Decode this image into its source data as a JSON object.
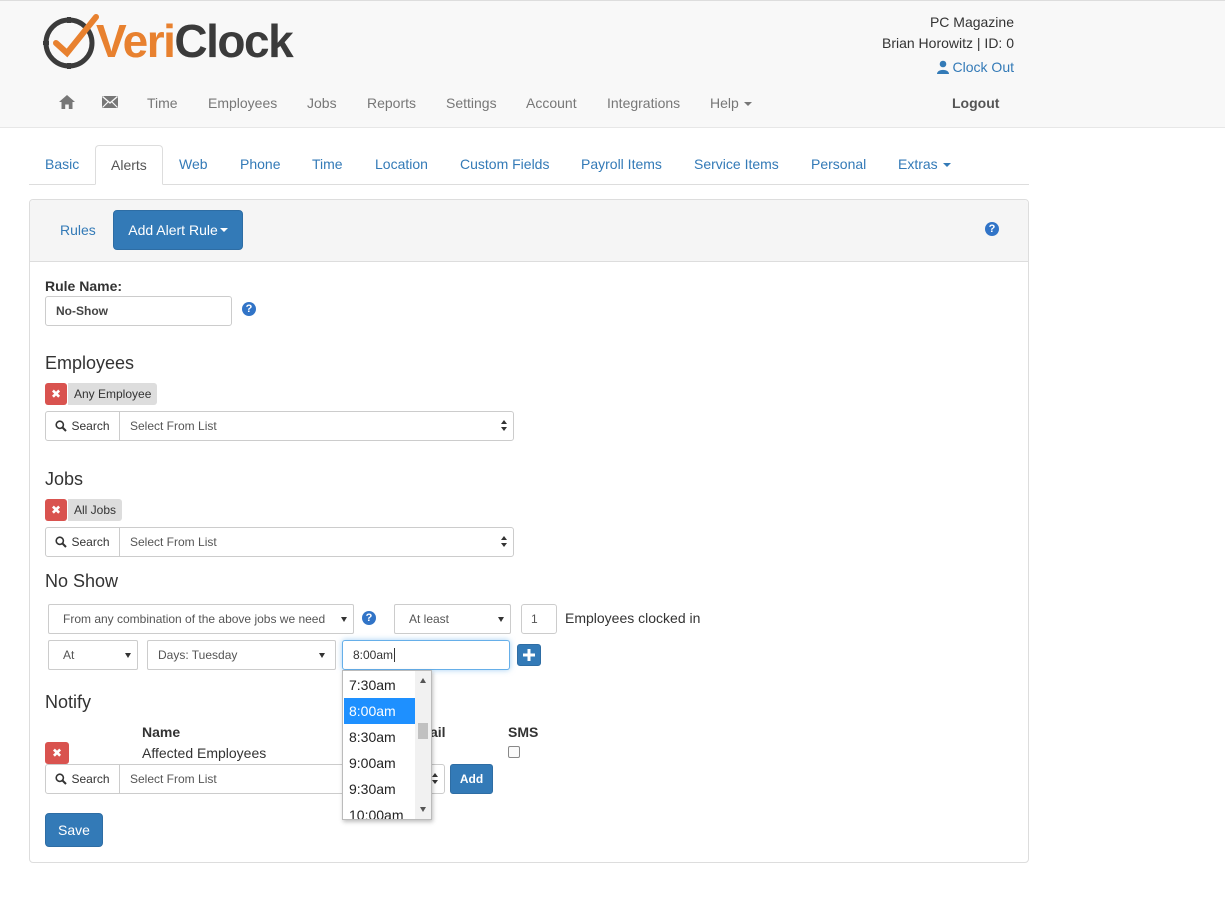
{
  "header": {
    "logo_part1": "Veri",
    "logo_part2": "Clock",
    "account_company": "PC Magazine",
    "account_user": "Brian Horowitz | ID: 0",
    "clock_out_label": "Clock Out",
    "nav": [
      "Time",
      "Employees",
      "Jobs",
      "Reports",
      "Settings",
      "Account",
      "Integrations",
      "Help"
    ],
    "logout_label": "Logout"
  },
  "tabs": [
    "Basic",
    "Alerts",
    "Web",
    "Phone",
    "Time",
    "Location",
    "Custom Fields",
    "Payroll Items",
    "Service Items",
    "Personal",
    "Extras"
  ],
  "active_tab": "Alerts",
  "panel": {
    "rules_link": "Rules",
    "add_rule_button": "Add Alert Rule"
  },
  "form": {
    "rule_name_label": "Rule Name:",
    "rule_name_value": "No-Show",
    "employees_heading": "Employees",
    "employees_chip": "Any Employee",
    "search_label": "Search",
    "select_placeholder": "Select From List",
    "jobs_heading": "Jobs",
    "jobs_chip": "All Jobs",
    "noshow_heading": "No Show",
    "combination_select": "From any combination of the above jobs we need",
    "atleast_select": "At least",
    "count_value": "1",
    "clocked_in_text": "Employees clocked in",
    "at_select": "At",
    "days_select": "Days: Tuesday",
    "time_value": "8:00am",
    "time_options": [
      "7:30am",
      "8:00am",
      "8:30am",
      "9:00am",
      "9:30am",
      "10:00am"
    ],
    "time_selected": "8:00am",
    "notify_heading": "Notify",
    "col_name": "Name",
    "col_email_partial": "ail",
    "col_sms": "SMS",
    "notify_row_name": "Affected Employees",
    "add_button": "Add",
    "save_button": "Save"
  },
  "colors": {
    "brand_orange": "#e8812f",
    "primary_blue": "#337ab7",
    "danger_red": "#d9534f",
    "highlight_blue": "#1e90ff"
  },
  "icons": [
    "home-icon",
    "envelope-icon",
    "user-icon",
    "help-icon",
    "remove-icon",
    "search-icon",
    "plus-icon"
  ]
}
